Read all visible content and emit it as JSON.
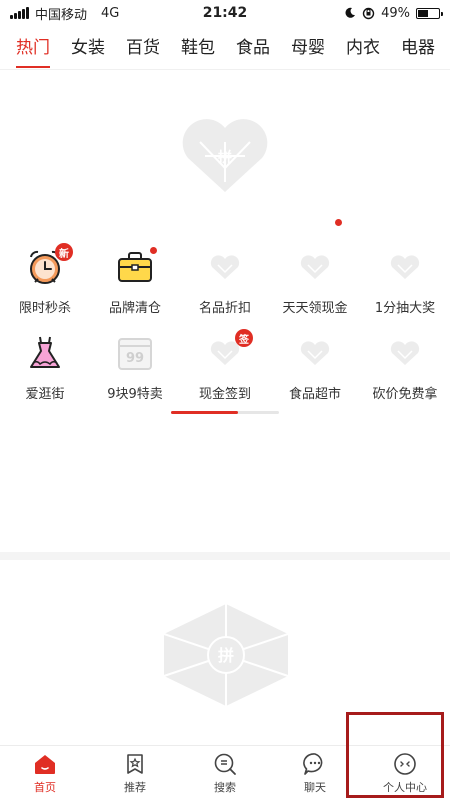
{
  "status_bar": {
    "carrier": "中国移动",
    "network": "4G",
    "time": "21:42",
    "battery_text": "49%",
    "battery_level": 0.49
  },
  "tabs": [
    {
      "label": "热门",
      "active": true
    },
    {
      "label": "女装"
    },
    {
      "label": "百货"
    },
    {
      "label": "鞋包"
    },
    {
      "label": "食品"
    },
    {
      "label": "母婴"
    },
    {
      "label": "内衣"
    },
    {
      "label": "电器"
    }
  ],
  "grid": {
    "row1": [
      {
        "label": "限时秒杀",
        "icon": "alarm-clock-icon",
        "badge": "新"
      },
      {
        "label": "品牌清仓",
        "icon": "briefcase-icon",
        "badge_dot": true
      },
      {
        "label": "名品折扣",
        "icon": "placeholder-heart-icon"
      },
      {
        "label": "天天领现金",
        "icon": "placeholder-heart-icon"
      },
      {
        "label": "1分抽大奖",
        "icon": "placeholder-heart-icon"
      }
    ],
    "row2": [
      {
        "label": "爱逛街",
        "icon": "dress-icon"
      },
      {
        "label": "9块9特卖",
        "icon": "calendar-99-icon",
        "icon_text": "99"
      },
      {
        "label": "现金签到",
        "icon": "placeholder-heart-icon",
        "badge": "签"
      },
      {
        "label": "食品超市",
        "icon": "placeholder-heart-icon"
      },
      {
        "label": "砍价免费拿",
        "icon": "placeholder-heart-icon"
      }
    ]
  },
  "scroll_progress": 0.62,
  "bottom_nav": [
    {
      "label": "首页",
      "icon": "home-icon",
      "active": true
    },
    {
      "label": "推荐",
      "icon": "star-bookmark-icon"
    },
    {
      "label": "搜索",
      "icon": "search-icon"
    },
    {
      "label": "聊天",
      "icon": "chat-bubble-icon"
    },
    {
      "label": "个人中心",
      "icon": "profile-face-icon"
    }
  ],
  "colors": {
    "accent": "#e02e24",
    "placeholder": "#ececec",
    "highlight": "#a61b1b"
  }
}
